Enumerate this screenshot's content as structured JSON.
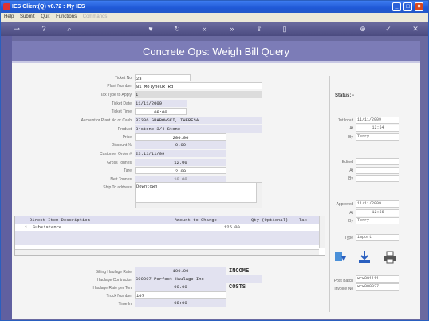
{
  "window": {
    "title": "IES Client(Q) v8.72 : My IES"
  },
  "menu": [
    "Help",
    "Submit",
    "Quit",
    "Functions"
  ],
  "menu_disabled": "Commands",
  "toolbar": [
    "key-icon",
    "help-icon",
    "search-icon",
    "heart-icon",
    "refresh-icon",
    "rewind-icon",
    "fast-forward-icon",
    "export-icon",
    "stop-icon",
    "add-icon",
    "check-icon",
    "close-icon"
  ],
  "page": {
    "title": "Concrete Ops: Weigh Bill Query"
  },
  "form": {
    "ticket_no": {
      "label": "Ticket No",
      "value": "23"
    },
    "plant_number": {
      "label": "Plant Number",
      "value": "81 Molyneux Rd"
    },
    "tax_type": {
      "label": "Tax Type to Apply",
      "value": "1"
    },
    "ticket_date": {
      "label": "Ticket Date",
      "value": "11/11/2009"
    },
    "ticket_time": {
      "label": "Ticket Time",
      "value": "08:00"
    },
    "account": {
      "label": "Account or Plant No or Cash",
      "value": "07306 GRABOWSKI, THERESA"
    },
    "product": {
      "label": "Product",
      "value": "34stone 3/4 Stone"
    },
    "price": {
      "label": "Price",
      "value": "200.00"
    },
    "discount": {
      "label": "Discount %",
      "value": "0.00"
    },
    "customer_order": {
      "label": "Customer Order #",
      "value": "23.11/11/09"
    },
    "gross_tonnes": {
      "label": "Gross Tonnes",
      "value": "12.00"
    },
    "tare": {
      "label": "Tare",
      "value": "2.00"
    },
    "nett_tonnes": {
      "label": "Nett Tonnes",
      "value": "10.00"
    },
    "ship_to": {
      "label": "Ship To address",
      "value": "Downtown"
    }
  },
  "grid": {
    "headers": [
      "Direct Item Description",
      "Amount to Charge",
      "Qty (Optional)",
      "Tax"
    ],
    "rows": [
      {
        "num": "1",
        "desc": "Subsistence",
        "amount": "125.00"
      }
    ]
  },
  "income": {
    "section_label": "INCOME",
    "billing_rate": {
      "label": "Billing Haulage Rate",
      "value": "100.00"
    },
    "contractor": {
      "label": "Haulage Contractor",
      "value": "C00007 Perfect Haulage Inc"
    }
  },
  "costs": {
    "section_label": "COSTS",
    "rate_per_ton": {
      "label": "Haulage Rate per Ton",
      "value": "90.00"
    },
    "truck_number": {
      "label": "Truck Number",
      "value": "107"
    },
    "time_in": {
      "label": "Time In",
      "value": "08:00"
    }
  },
  "right": {
    "status_label": "Status: -",
    "first_input": {
      "label": "1st Input",
      "date": "11/11/2009"
    },
    "at1": {
      "label": "At",
      "value": "12:54"
    },
    "by1": {
      "label": "By",
      "value": "Terry"
    },
    "edited": {
      "label": "Edited"
    },
    "at2": {
      "label": "At"
    },
    "by2": {
      "label": "By"
    },
    "approved": {
      "label": "Approved",
      "date": "11/11/2009"
    },
    "at3": {
      "label": "At",
      "value": "12:56"
    },
    "by3": {
      "label": "By",
      "value": "Terry"
    },
    "type": {
      "label": "Type",
      "value": "import"
    },
    "post_batch": {
      "label": "Post Batch",
      "value": "wcw091111"
    },
    "invoice_no": {
      "label": "Invoice No",
      "value": "wcw000037"
    }
  }
}
